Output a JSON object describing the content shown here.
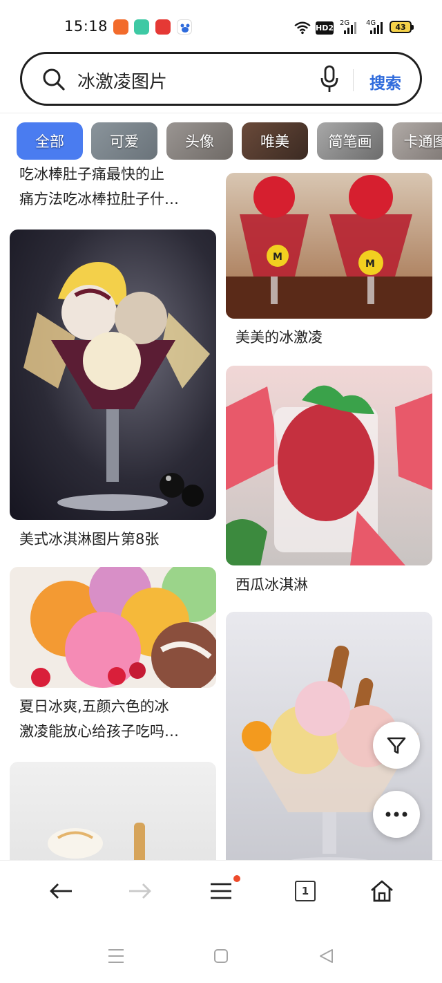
{
  "status_bar": {
    "time": "15:18",
    "battery": "43",
    "network_hd": "HD2",
    "signal_2g": "2G",
    "signal_4g": "4G"
  },
  "search": {
    "query": "冰激凌图片",
    "button_label": "搜索"
  },
  "chips": [
    {
      "label": "全部",
      "active": true
    },
    {
      "label": "可爱",
      "active": false
    },
    {
      "label": "头像",
      "active": false
    },
    {
      "label": "唯美",
      "active": false
    },
    {
      "label": "简笔画",
      "active": false
    },
    {
      "label": "卡通图",
      "active": false
    }
  ],
  "feed": {
    "left": [
      {
        "caption_line1": "吃冰棒肚子痛最快的止",
        "caption_line2": "痛方法吃冰棒拉肚子什…",
        "image": "partial-top"
      },
      {
        "caption_line1": "美式冰淇淋图片第8张",
        "image": "sundae-glass-dark-bg"
      },
      {
        "caption_line1": "夏日冰爽,五颜六色的冰",
        "caption_line2": "激凌能放心给孩子吃吗…",
        "image": "colorful-scoops-raspberries"
      },
      {
        "image": "vanilla-cone-partial"
      }
    ],
    "right": [
      {
        "caption_line1": "美美的冰激凌",
        "image": "strawberry-parfaits"
      },
      {
        "caption_line1": "西瓜冰淇淋",
        "image": "watermelon-sorbet-mint"
      },
      {
        "image": "sundae-wafer-sticks"
      }
    ]
  },
  "colors": {
    "accent": "#4a7cf0",
    "search_blue": "#2f6bdc",
    "badge_red": "#ee4b2b"
  },
  "bottom_nav": {
    "tab_count": "1"
  }
}
